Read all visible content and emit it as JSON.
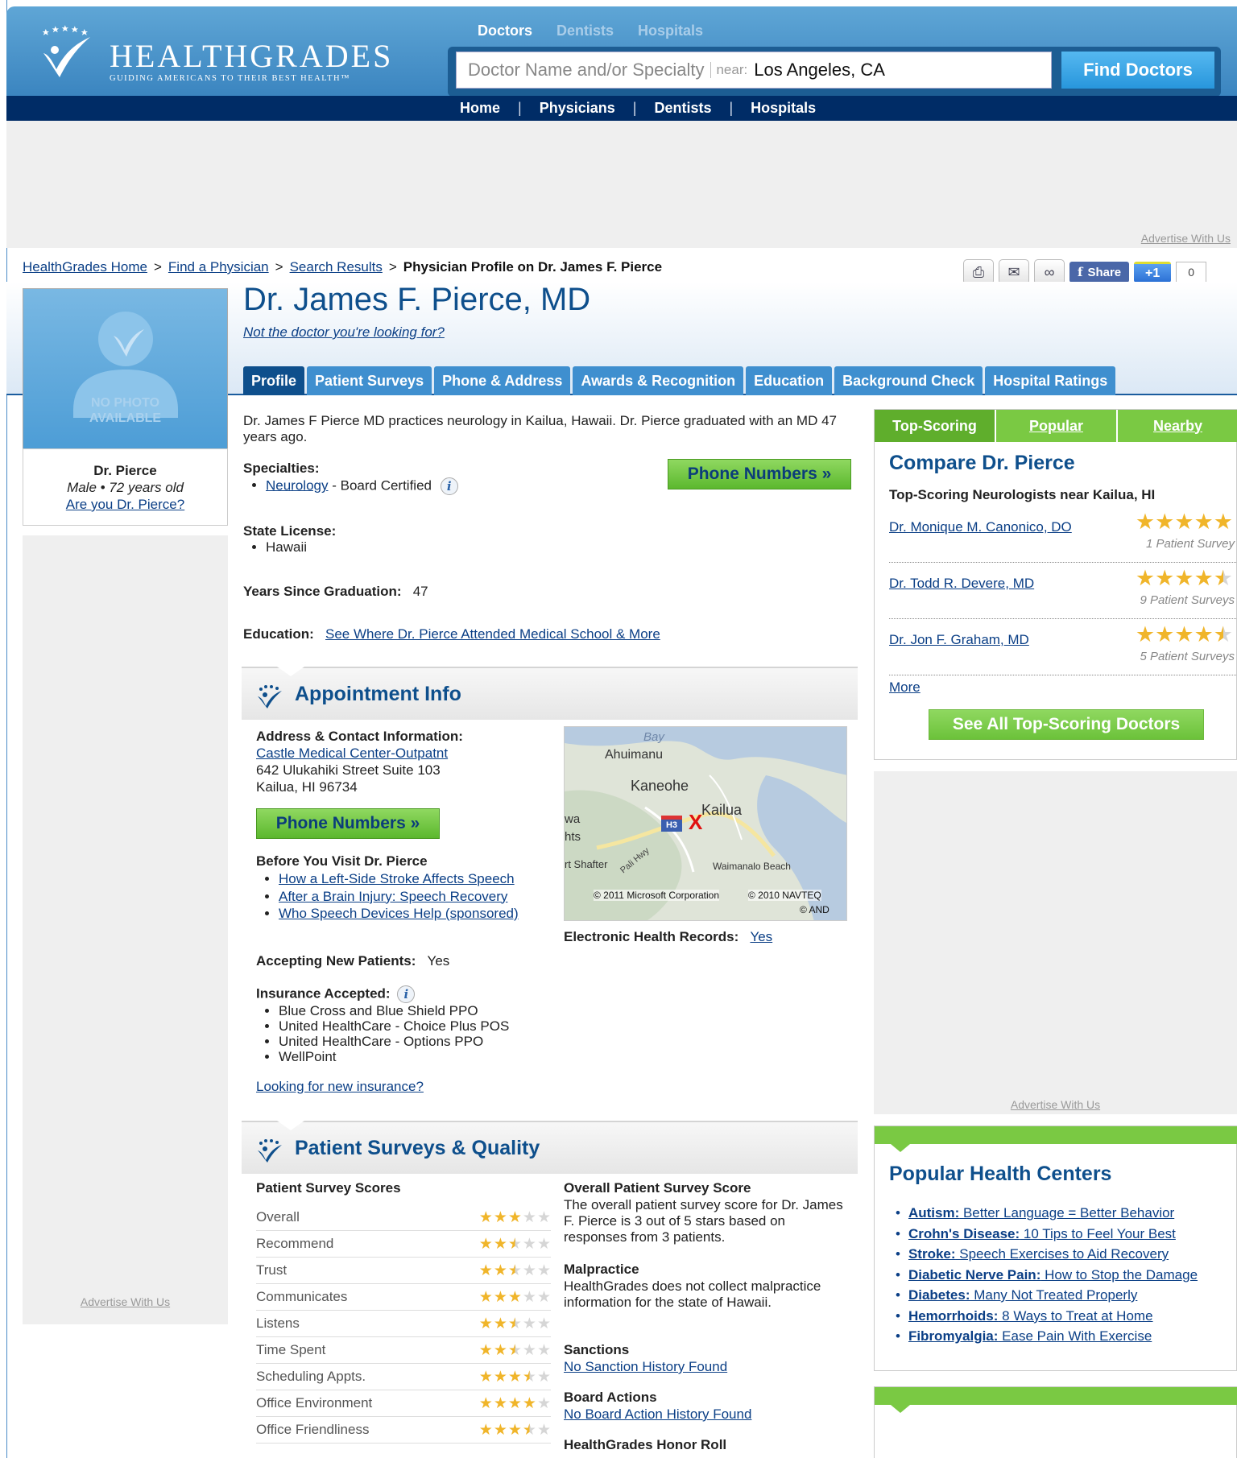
{
  "header": {
    "logo_text": "HEALTHGRADES",
    "tagline": "GUIDING AMERICANS TO THEIR BEST HEALTH™",
    "search_tabs": [
      "Doctors",
      "Dentists",
      "Hospitals"
    ],
    "search_placeholder": "Doctor Name and/or Specialty",
    "near_label": "near:",
    "location_value": "Los Angeles, CA",
    "find_button": "Find Doctors",
    "nav": [
      "Home",
      "Physicians",
      "Dentists",
      "Hospitals"
    ],
    "nav_sep": "|"
  },
  "ads": {
    "advertise_label": "Advertise With Us"
  },
  "breadcrumb": {
    "items": [
      "HealthGrades Home",
      "Find a Physician",
      "Search Results"
    ],
    "current": "Physician Profile on Dr. James F. Pierce",
    "sep": ">"
  },
  "share": {
    "share_label": "Share",
    "gplus_label": "+1",
    "gplus_count": "0"
  },
  "profile": {
    "photo_placeholder_1": "NO PHOTO",
    "photo_placeholder_2": "AVAILABLE",
    "short_name": "Dr. Pierce",
    "gender_age": "Male • 72 years old",
    "claim_link": "Are you Dr. Pierce?",
    "full_name": "Dr. James F. Pierce, MD",
    "not_doctor": "Not the doctor you're looking for?",
    "tabs": [
      "Profile",
      "Patient Surveys",
      "Phone & Address",
      "Awards & Recognition",
      "Education",
      "Background Check",
      "Hospital Ratings"
    ],
    "intro": "Dr. James F Pierce MD practices neurology in Kailua, Hawaii. Dr. Pierce graduated with an MD 47 years ago.",
    "specialties_label": "Specialties:",
    "specialty": "Neurology",
    "specialty_suffix": " - Board Certified",
    "phone_button": "Phone Numbers »",
    "license_label": "State License:",
    "license_state": "Hawaii",
    "years_label": "Years Since Graduation:",
    "years_value": "47",
    "education_label": "Education:",
    "education_link": "See Where Dr. Pierce Attended Medical School & More"
  },
  "appointment": {
    "title": "Appointment Info",
    "address_label": "Address & Contact Information:",
    "facility": "Castle Medical Center-Outpatnt",
    "street": "642 Ulukahiki Street Suite 103",
    "city": "Kailua, HI 96734",
    "phone_button": "Phone Numbers »",
    "before_label": "Before You Visit Dr. Pierce",
    "before_links": [
      "How a Left-Side Stroke Affects Speech",
      "After a Brain Injury: Speech Recovery",
      "Who Speech Devices Help (sponsored)"
    ],
    "ehr_label": "Electronic Health Records:",
    "ehr_value": "Yes",
    "accepting_label": "Accepting New Patients:",
    "accepting_value": "Yes",
    "insurance_label": "Insurance Accepted:",
    "insurance": [
      "Blue Cross and Blue Shield PPO",
      "United HealthCare - Choice Plus POS",
      "United HealthCare - Options PPO",
      "WellPoint"
    ],
    "new_insurance_link": "Looking for new insurance?",
    "map": {
      "labels": [
        "Bay",
        "Ahuimanu",
        "Kaneohe",
        "Kailua",
        "wa",
        "hts",
        "rt Shafter",
        "Pali Hwy",
        "Waimanalo Beach",
        "H3"
      ],
      "copyright_1": "© 2011 Microsoft Corporation",
      "copyright_2": "© 2010 NAVTEQ",
      "copyright_3": "© AND",
      "marker": "X"
    }
  },
  "surveys": {
    "title": "Patient Surveys & Quality",
    "scores_label": "Patient Survey Scores",
    "rows": [
      {
        "label": "Overall",
        "rating": 3
      },
      {
        "label": "Recommend",
        "rating": 2.5
      },
      {
        "label": "Trust",
        "rating": 2.5
      },
      {
        "label": "Communicates",
        "rating": 3
      },
      {
        "label": "Listens",
        "rating": 2.5
      },
      {
        "label": "Time Spent",
        "rating": 2.5
      },
      {
        "label": "Scheduling Appts.",
        "rating": 3.5
      },
      {
        "label": "Office Environment",
        "rating": 4
      },
      {
        "label": "Office Friendliness",
        "rating": 3.5
      }
    ],
    "overall_label": "Overall Patient Survey Score",
    "overall_text": "The overall patient survey score for Dr. James F. Pierce is 3 out of 5 stars based on responses from 3 patients.",
    "malpractice_label": "Malpractice",
    "malpractice_text": "HealthGrades does not collect malpractice information for the state of Hawaii.",
    "sanctions_label": "Sanctions",
    "sanctions_link": "No Sanction History Found",
    "board_label": "Board Actions",
    "board_link": "No Board Action History Found",
    "honor_label": "HealthGrades Honor Roll"
  },
  "compare": {
    "tabs": [
      "Top-Scoring",
      "Popular",
      "Nearby"
    ],
    "title": "Compare Dr. Pierce",
    "subtitle": "Top-Scoring Neurologists near Kailua, HI",
    "doctors": [
      {
        "name": "Dr. Monique M. Canonico, DO",
        "rating": 5,
        "surveys": "1 Patient Survey"
      },
      {
        "name": "Dr. Todd R. Devere, MD",
        "rating": 4.5,
        "surveys": "9 Patient Surveys"
      },
      {
        "name": "Dr. Jon F. Graham, MD",
        "rating": 4.5,
        "surveys": "5 Patient Surveys"
      }
    ],
    "more_link": "More",
    "see_all_button": "See All Top-Scoring Doctors"
  },
  "health_centers": {
    "title": "Popular Health Centers",
    "items": [
      {
        "topic": "Autism:",
        "text": " Better Language = Better Behavior"
      },
      {
        "topic": "Crohn's Disease:",
        "text": " 10 Tips to Feel Your Best"
      },
      {
        "topic": "Stroke:",
        "text": " Speech Exercises to Aid Recovery"
      },
      {
        "topic": "Diabetic Nerve Pain:",
        "text": " How to Stop the Damage"
      },
      {
        "topic": "Diabetes:",
        "text": " Many Not Treated Properly"
      },
      {
        "topic": "Hemorrhoids:",
        "text": " 8 Ways to Treat at Home"
      },
      {
        "topic": "Fibromyalgia:",
        "text": " Ease Pain With Exercise"
      }
    ]
  },
  "colors": {
    "brand_blue": "#0e4f8c",
    "nav_navy": "#002c66",
    "accent_green": "#7ac943",
    "star_gold": "#f0b52a"
  }
}
